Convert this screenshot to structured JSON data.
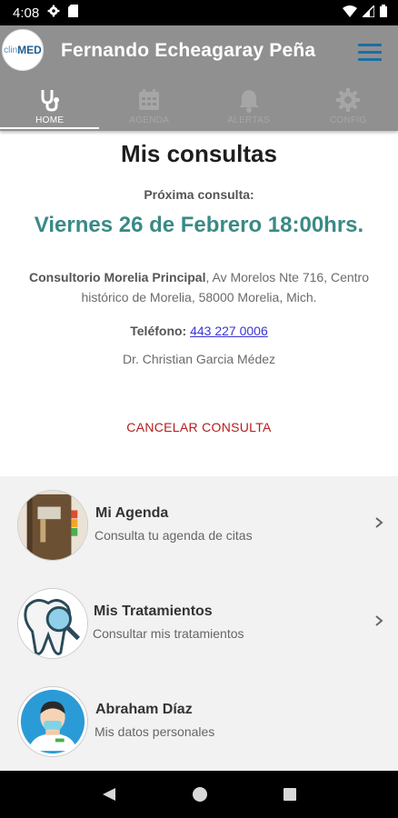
{
  "status_bar": {
    "time": "4:08"
  },
  "header": {
    "logo_text_light": "clin",
    "logo_text_bold": "MED",
    "title": "Fernando Echeagaray Peña"
  },
  "tabs": [
    {
      "label": "HOME",
      "icon": "stethoscope-icon",
      "active": true
    },
    {
      "label": "AGENDA",
      "icon": "calendar-icon",
      "active": false
    },
    {
      "label": "ALERTAS",
      "icon": "bell-icon",
      "active": false
    },
    {
      "label": "CONFIG",
      "icon": "gear-icon",
      "active": false
    }
  ],
  "main": {
    "title": "Mis consultas",
    "next_label": "Próxima consulta:",
    "next_date": "Viernes 26 de Febrero 18:00hrs.",
    "address_bold": "Consultorio Morelia Principal",
    "address_rest": ", Av Morelos Nte 716, Centro histórico de Morelia, 58000 Morelia, Mich.",
    "phone_label": "Teléfono:",
    "phone_value": "443 227 0006",
    "doctor": "Dr. Christian Garcia Médez",
    "cancel_label": "CANCELAR CONSULTA"
  },
  "menu_items": [
    {
      "title": "Mi Agenda",
      "subtitle": "Consulta tu agenda de citas",
      "icon": "agenda-book-icon"
    },
    {
      "title": "Mis Tratamientos",
      "subtitle": "Consultar mis tratamientos",
      "icon": "tooth-magnifier-icon"
    },
    {
      "title": "Abraham Díaz",
      "subtitle": "Mis datos personales",
      "icon": "doctor-avatar-icon"
    }
  ],
  "colors": {
    "header_bg": "#909090",
    "accent_teal": "#3a8a85",
    "cancel_red": "#b71c1c",
    "link_blue": "#3a35d4",
    "menu_blue": "#1c6ea4"
  }
}
